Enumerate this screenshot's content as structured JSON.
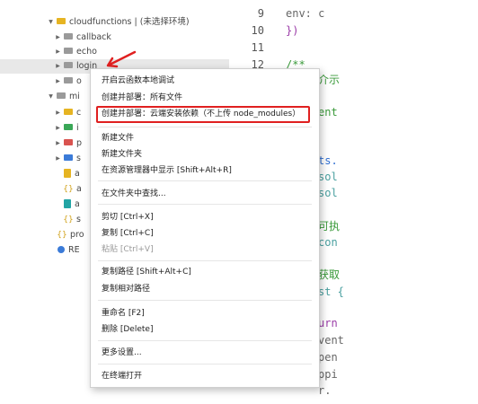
{
  "tree": {
    "root": "cloudfunctions | (未选择环境)",
    "items": [
      {
        "label": "callback"
      },
      {
        "label": "echo"
      },
      {
        "label": "login"
      },
      {
        "label": "o"
      },
      {
        "label": "mi"
      },
      {
        "label": "c"
      },
      {
        "label": "i"
      },
      {
        "label": "p"
      },
      {
        "label": "s"
      },
      {
        "label": "a"
      },
      {
        "label": "a"
      },
      {
        "label": "a"
      },
      {
        "label": "s"
      },
      {
        "label": "pro"
      },
      {
        "label": "RE"
      }
    ]
  },
  "editor": {
    "line_numbers": [
      "9",
      "10",
      "11",
      "12"
    ],
    "lines": [
      "env: c",
      "})",
      "",
      "/**",
      "介示",
      "ent",
      "ts.",
      "sol",
      "sol",
      "可执",
      "con",
      "获取",
      "st {",
      "urn",
      "vent",
      "pen",
      "ppi",
      "r."
    ]
  },
  "context_menu": {
    "items": [
      {
        "label": "开启云函数本地调试"
      },
      {
        "label": "创建并部署：所有文件"
      },
      {
        "label": "创建并部署：云端安装依赖（不上传 node_modules）"
      },
      {
        "label": "新建文件"
      },
      {
        "label": "新建文件夹"
      },
      {
        "label": "在资源管理器中显示 [Shift+Alt+R]"
      },
      {
        "label": "在文件夹中查找..."
      },
      {
        "label": "剪切 [Ctrl+X]"
      },
      {
        "label": "复制 [Ctrl+C]"
      },
      {
        "label": "粘贴 [Ctrl+V]"
      },
      {
        "label": "复制路径 [Shift+Alt+C]"
      },
      {
        "label": "复制相对路径"
      },
      {
        "label": "重命名 [F2]"
      },
      {
        "label": "删除 [Delete]"
      },
      {
        "label": "更多设置..."
      },
      {
        "label": "在终端打开"
      }
    ]
  },
  "colors": {
    "highlight_box": "#e02020",
    "arrow": "#e02020",
    "selected_row": "#e8e8e8"
  }
}
